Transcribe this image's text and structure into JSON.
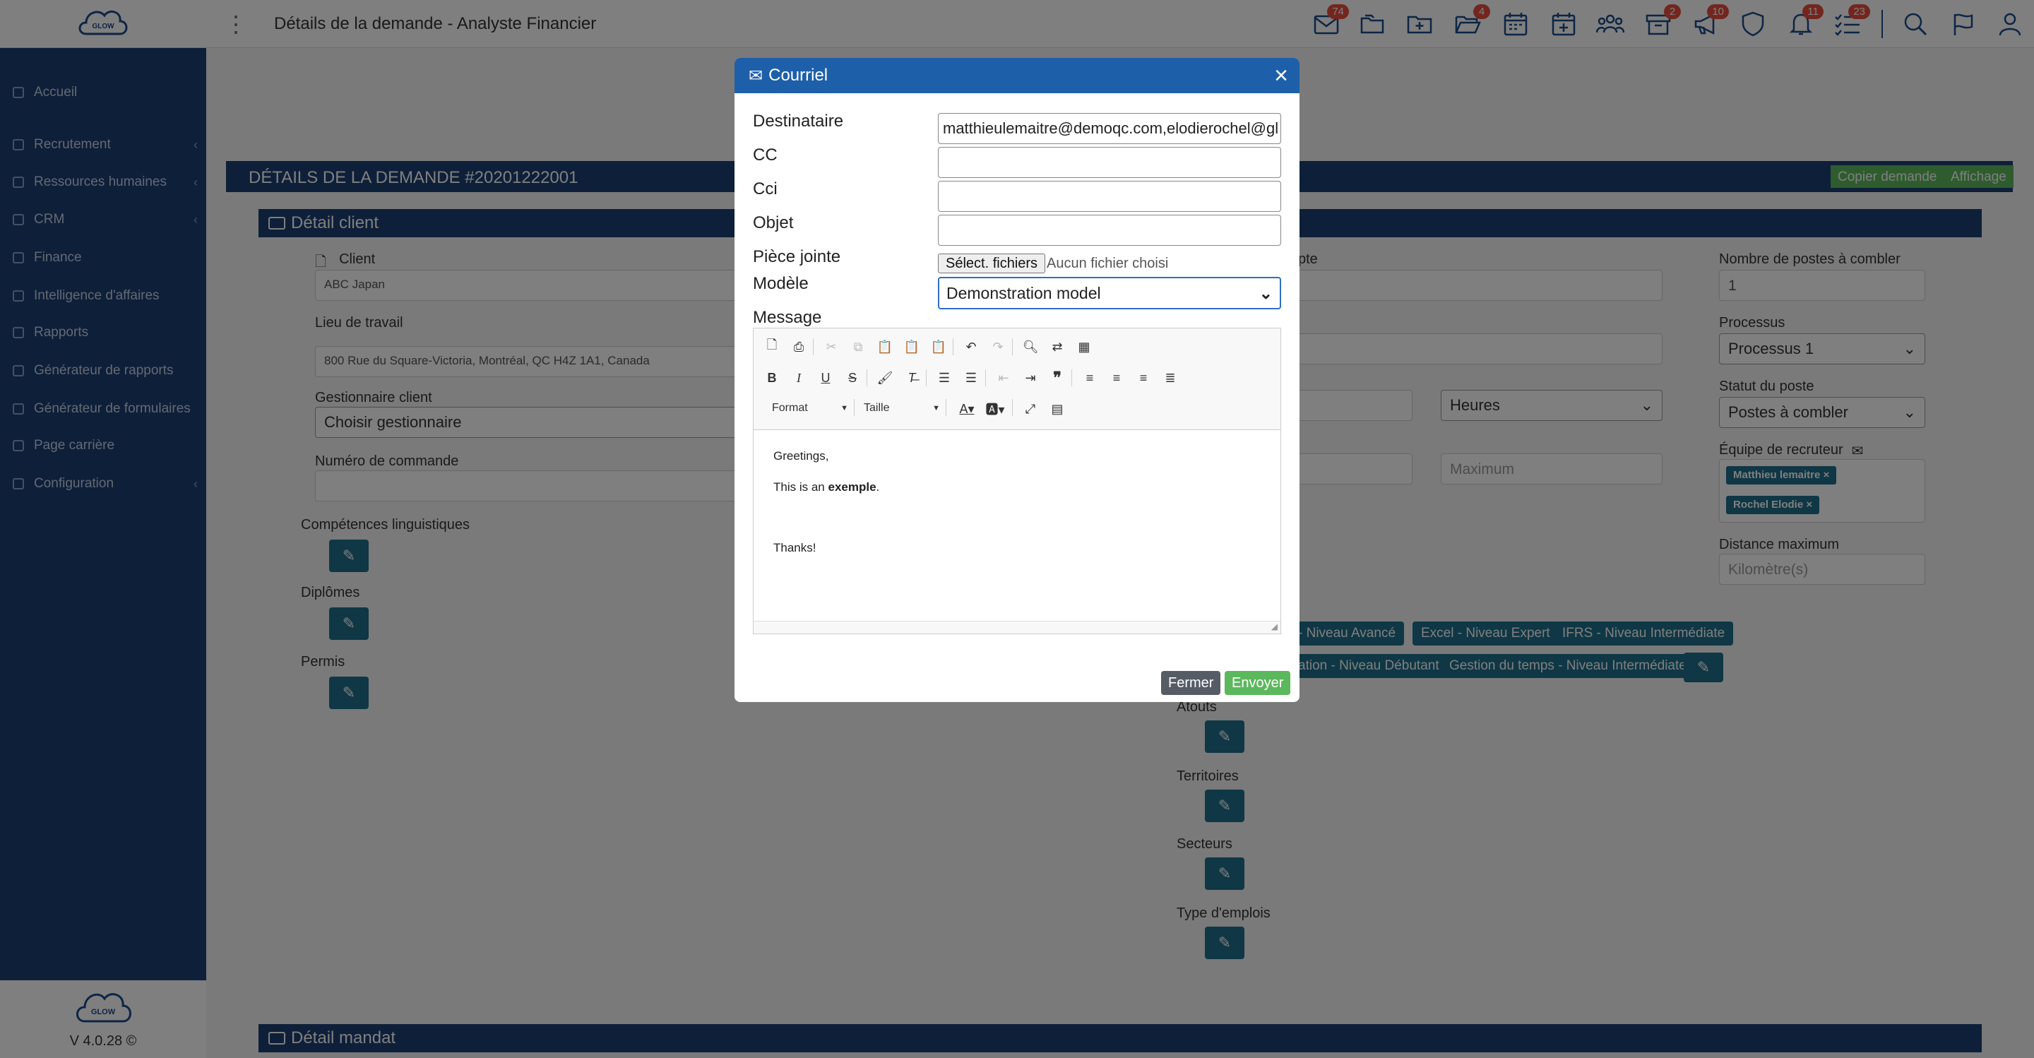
{
  "topbar": {
    "title": "Détails de la demande - Analyste Financier",
    "badges": {
      "mail": "74",
      "folder_add": "4",
      "box": "2",
      "megaphone": "10",
      "bell": "11",
      "tasks": "23"
    }
  },
  "sidebar": {
    "items": [
      {
        "label": "Accueil"
      },
      {
        "label": "Recrutement"
      },
      {
        "label": "Ressources humaines"
      },
      {
        "label": "CRM"
      },
      {
        "label": "Finance"
      },
      {
        "label": "Intelligence d'affaires"
      },
      {
        "label": "Rapports"
      },
      {
        "label": "Générateur de rapports"
      },
      {
        "label": "Générateur de formulaires"
      },
      {
        "label": "Page carrière"
      },
      {
        "label": "Configuration"
      }
    ],
    "logo_text": "GLOW",
    "version": "V 4.0.28 ©"
  },
  "main": {
    "demand_title": "DÉTAILS DE LA DEMANDE #20201222001",
    "copy_btn": "Copier demande",
    "view_btn": "Affichage",
    "client_section": "Détail client",
    "mandate_section": "Détail mandat",
    "client_label": "Client",
    "client_value": "ABC Japan",
    "workplace_label": "Lieu de travail",
    "workplace_value": "800 Rue du Square-Victoria, Montréal, QC H4Z 1A1, Canada",
    "manager_label": "Gestionnaire client",
    "manager_value": "Choisir gestionnaire",
    "order_label": "Numéro de commande",
    "lang_label": "Compétences linguistiques",
    "diploma_label": "Diplômes",
    "permit_label": "Permis",
    "right_partial_label": "pte",
    "positions_label": "Nombre de postes à combler",
    "positions_value": "1",
    "process_label": "Processus",
    "process_value": "Processus 1",
    "hours_value": "Heures",
    "status_label": "Statut du poste",
    "status_value": "Postes à combler",
    "max_placeholder": "Maximum",
    "team_label": "Équipe de recruteur",
    "team_tags": [
      "Matthieu lemaitre",
      "Rochel Elodie"
    ],
    "distance_label": "Distance maximum",
    "distance_placeholder": "Kilomètre(s)",
    "skill_tags_row1": [
      "- Niveau Avancé",
      "Excel - Niveau Expert",
      "IFRS - Niveau Intermédiate"
    ],
    "skill_tags_row2": [
      "ation - Niveau Débutant",
      "Gestion du temps - Niveau Intermédiate"
    ],
    "assets_label": "Atouts",
    "territories_label": "Territoires",
    "sectors_label": "Secteurs",
    "job_types_label": "Type d'emplois"
  },
  "modal": {
    "title": "Courriel",
    "to_label": "Destinataire",
    "to_value": "matthieulemaitre@demoqc.com,elodierochel@gl",
    "cc_label": "CC",
    "bcc_label": "Cci",
    "subject_label": "Objet",
    "attachment_label": "Pièce jointe",
    "file_button": "Sélect. fichiers",
    "file_none": "Aucun fichier choisi",
    "template_label": "Modèle",
    "template_value": "Demonstration model",
    "message_label": "Message",
    "format_label": "Format",
    "size_label": "Taille",
    "body": {
      "line1": "Greetings,",
      "line2_a": "This is an ",
      "line2_bold": "exemple",
      "line2_end": ".",
      "line3": "Thanks!"
    },
    "close_btn": "Fermer",
    "send_btn": "Envoyer"
  }
}
